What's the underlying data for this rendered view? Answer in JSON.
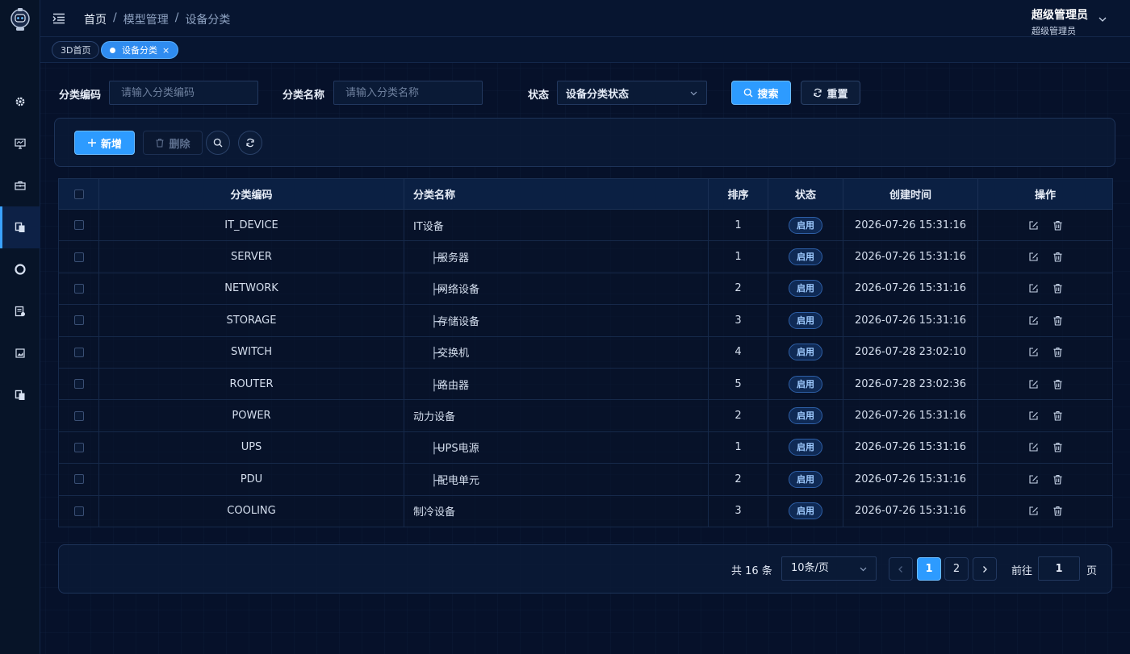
{
  "colors": {
    "accent": "#2d9bff",
    "background": "#06112a",
    "badge": "#9fcbff"
  },
  "sidebar": {
    "logo": "robot-logo",
    "items": [
      {
        "icon": "gear-icon"
      },
      {
        "icon": "monitor-icon"
      },
      {
        "icon": "toolbox-icon"
      },
      {
        "icon": "copy-icon",
        "active": true
      },
      {
        "icon": "lifebuoy-icon"
      },
      {
        "icon": "server-doc-icon"
      },
      {
        "icon": "image-icon"
      },
      {
        "icon": "copy-icon"
      }
    ]
  },
  "header": {
    "breadcrumb": [
      "首页",
      "模型管理",
      "设备分类"
    ],
    "separator": "/",
    "user_name": "超级管理员",
    "user_role": "超级管理员"
  },
  "tags": {
    "home": "3D首页",
    "active": "设备分类",
    "close": "×"
  },
  "search": {
    "code_label": "分类编码",
    "code_placeholder": "请输入分类编码",
    "name_label": "分类名称",
    "name_placeholder": "请输入分类名称",
    "status_label": "状态",
    "status_value": "设备分类状态",
    "search_button": "搜索",
    "reset_button": "重置"
  },
  "toolbar": {
    "add_button": "新增",
    "delete_button": "删除"
  },
  "table": {
    "columns": [
      "分类编码",
      "分类名称",
      "排序",
      "状态",
      "创建时间",
      "操作"
    ],
    "rows": [
      {
        "code": "IT_DEVICE",
        "prefix": "",
        "name": "IT设备",
        "sort": "1",
        "status": "启用",
        "time": "2026-07-26 15:31:16"
      },
      {
        "code": "SERVER",
        "prefix": "├─",
        "name": "服务器",
        "sort": "1",
        "status": "启用",
        "time": "2026-07-26 15:31:16"
      },
      {
        "code": "NETWORK",
        "prefix": "├─",
        "name": "网络设备",
        "sort": "2",
        "status": "启用",
        "time": "2026-07-26 15:31:16"
      },
      {
        "code": "STORAGE",
        "prefix": "├─",
        "name": "存储设备",
        "sort": "3",
        "status": "启用",
        "time": "2026-07-26 15:31:16"
      },
      {
        "code": "SWITCH",
        "prefix": "├─",
        "name": "交换机",
        "sort": "4",
        "status": "启用",
        "time": "2026-07-28 23:02:10"
      },
      {
        "code": "ROUTER",
        "prefix": "├─",
        "name": "路由器",
        "sort": "5",
        "status": "启用",
        "time": "2026-07-28 23:02:36"
      },
      {
        "code": "POWER",
        "prefix": "",
        "name": "动力设备",
        "sort": "2",
        "status": "启用",
        "time": "2026-07-26 15:31:16"
      },
      {
        "code": "UPS",
        "prefix": "├─",
        "name": "UPS电源",
        "sort": "1",
        "status": "启用",
        "time": "2026-07-26 15:31:16"
      },
      {
        "code": "PDU",
        "prefix": "├─",
        "name": "配电单元",
        "sort": "2",
        "status": "启用",
        "time": "2026-07-26 15:31:16"
      },
      {
        "code": "COOLING",
        "prefix": "",
        "name": "制冷设备",
        "sort": "3",
        "status": "启用",
        "time": "2026-07-26 15:31:16"
      }
    ]
  },
  "pagination": {
    "total": "共 16 条",
    "page_size": "10条/页",
    "pages": [
      "1",
      "2"
    ],
    "current": "1",
    "goto_label": "前往",
    "goto_value": "1",
    "goto_unit": "页"
  }
}
